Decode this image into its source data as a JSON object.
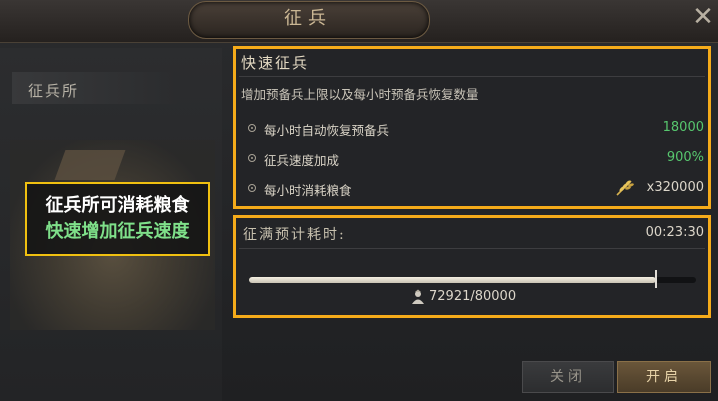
{
  "header": {
    "title": "征兵",
    "close_icon": "close-icon"
  },
  "sidebar": {
    "tab_label": "征兵所"
  },
  "promo": {
    "line1": "征兵所可消耗粮食",
    "line2": "快速增加征兵速度",
    "line2_color": "#7fe08a"
  },
  "quick_recruit": {
    "title": "快速征兵",
    "description": "增加预备兵上限以及每小时预备兵恢复数量",
    "rows": [
      {
        "label": "每小时自动恢复预备兵",
        "value": "18000",
        "color": "#57c66e"
      },
      {
        "label": "征兵速度加成",
        "value": "900%",
        "color": "#57c66e"
      },
      {
        "label": "每小时消耗粮食",
        "value": "x320000",
        "icon": "wheat-icon",
        "color": "#dcd6ca"
      }
    ]
  },
  "recruit_progress": {
    "title": "征满预计耗时:",
    "time": "00:23:30",
    "current": 72921,
    "max": 80000,
    "count_text": "72921/80000",
    "icon": "troop-icon"
  },
  "buttons": {
    "close_label": "关闭",
    "open_label": "开启"
  },
  "colors": {
    "highlight_border": "#f5ab1a",
    "green_value": "#57c66e"
  }
}
